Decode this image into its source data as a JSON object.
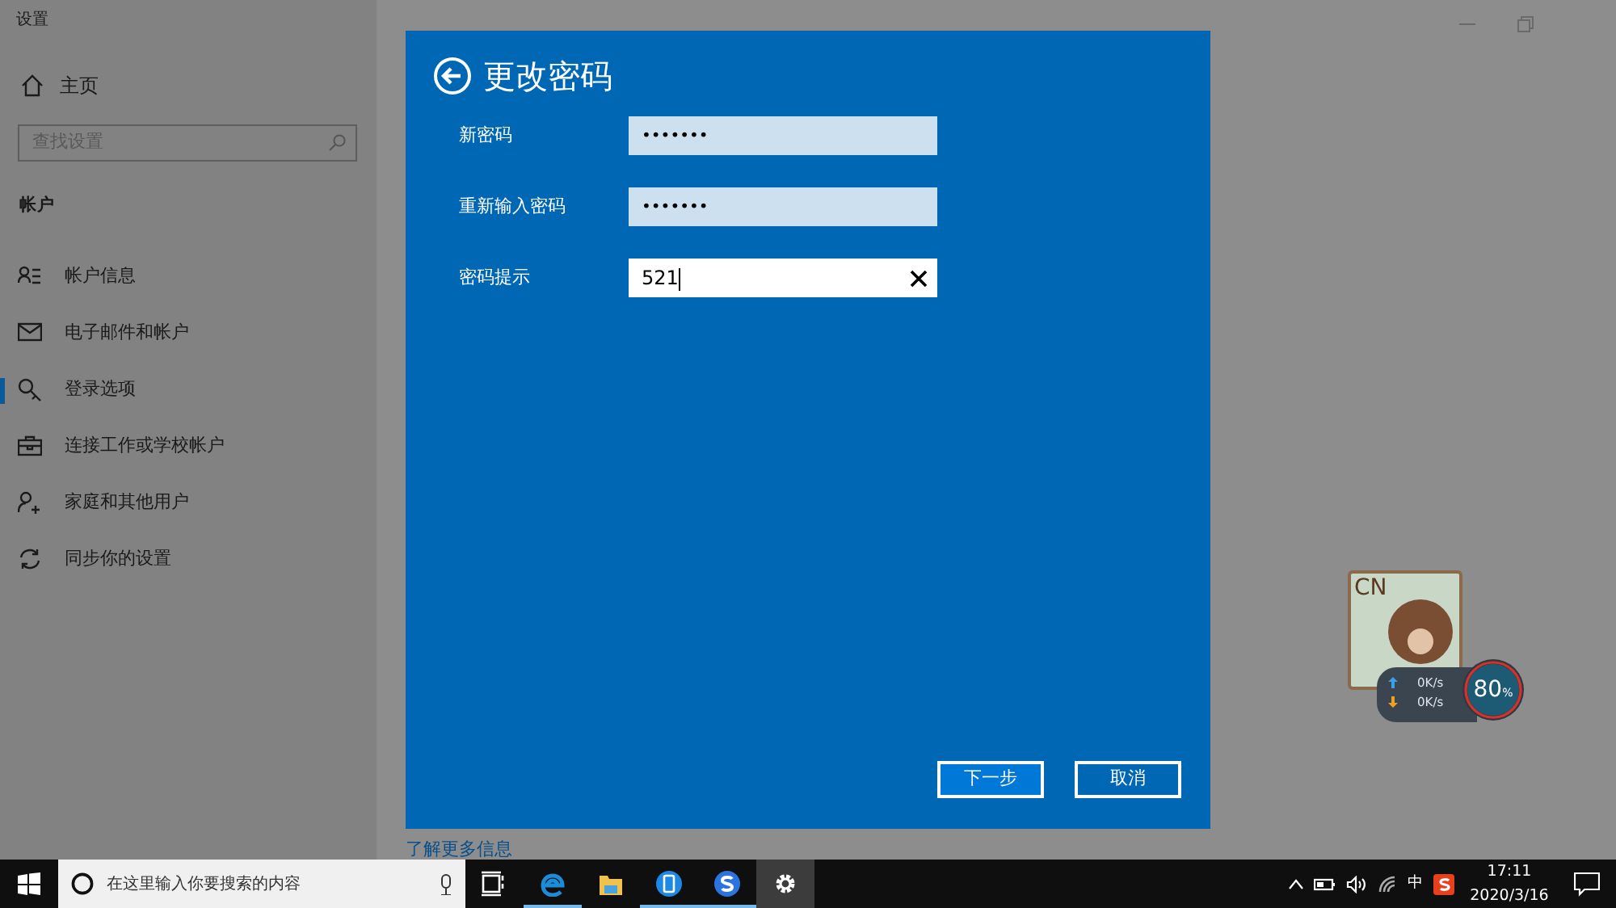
{
  "window": {
    "title": "设置"
  },
  "sidebar": {
    "home": "主页",
    "search": {
      "placeholder": "查找设置"
    },
    "section": "帐户",
    "items": [
      {
        "label": "帐户信息",
        "selected": false
      },
      {
        "label": "电子邮件和帐户",
        "selected": false
      },
      {
        "label": "登录选项",
        "selected": true
      },
      {
        "label": "连接工作或学校帐户",
        "selected": false
      },
      {
        "label": "家庭和其他用户",
        "selected": false
      },
      {
        "label": "同步你的设置",
        "selected": false
      }
    ]
  },
  "dialog": {
    "title": "更改密码",
    "fields": [
      {
        "label": "新密码",
        "kind": "password",
        "value": "•••••••",
        "focused": false
      },
      {
        "label": "重新输入密码",
        "kind": "password",
        "value": "•••••••",
        "focused": false
      },
      {
        "label": "密码提示",
        "kind": "text",
        "value": "521",
        "focused": true
      }
    ],
    "buttons": [
      {
        "label": "下一步",
        "kind": "primary"
      },
      {
        "label": "取消",
        "kind": "secondary"
      }
    ]
  },
  "link": "了解更多信息",
  "widget": {
    "region": "CN",
    "upload": "0K/s",
    "download": "0K/s",
    "percent": "80",
    "unit": "%"
  },
  "taskbar": {
    "search": {
      "placeholder": "在这里输入你要搜索的内容"
    },
    "apps": [
      {
        "kind": "taskview",
        "running": false,
        "selected": false
      },
      {
        "kind": "edge",
        "running": true,
        "selected": false
      },
      {
        "kind": "folder",
        "running": false,
        "selected": false
      },
      {
        "kind": "phone",
        "running": true,
        "selected": false
      },
      {
        "kind": "sogou",
        "running": true,
        "selected": false
      },
      {
        "kind": "settings",
        "running": false,
        "selected": true
      }
    ],
    "ime": "中",
    "time": "17:11",
    "date": "2020/3/16"
  }
}
